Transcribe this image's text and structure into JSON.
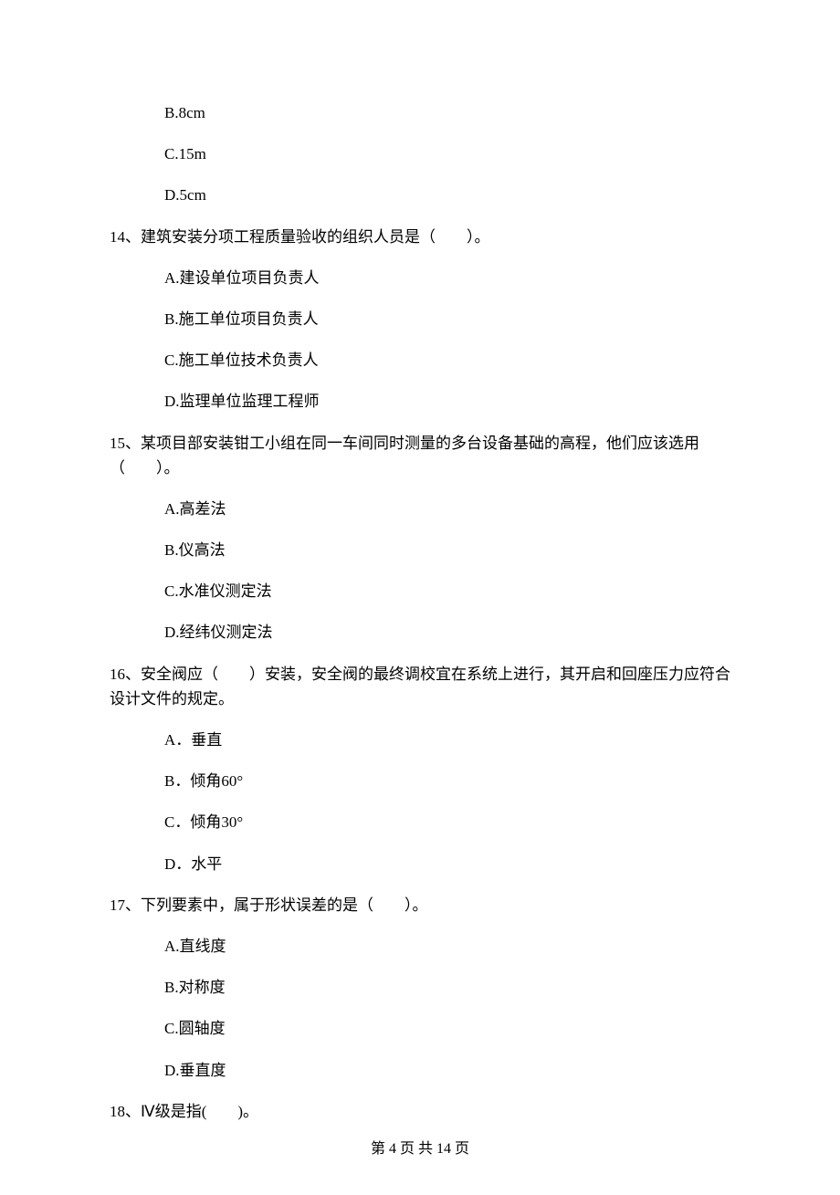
{
  "options_top": {
    "B": "B.8cm",
    "C": "C.15m",
    "D": "D.5cm"
  },
  "q14": {
    "text": "14、建筑安装分项工程质量验收的组织人员是（　　）。",
    "A": "A.建设单位项目负责人",
    "B": "B.施工单位项目负责人",
    "C": "C.施工单位技术负责人",
    "D": "D.监理单位监理工程师"
  },
  "q15": {
    "text": "15、某项目部安装钳工小组在同一车间同时测量的多台设备基础的高程，他们应该选用（　　）。",
    "A": "A.高差法",
    "B": "B.仪高法",
    "C": "C.水准仪测定法",
    "D": "D.经纬仪测定法"
  },
  "q16": {
    "text": "16、安全阀应（　　）安装，安全阀的最终调校宜在系统上进行，其开启和回座压力应符合设计文件的规定。",
    "A": "A．垂直",
    "B": "B．倾角60°",
    "C": "C．倾角30°",
    "D": "D．水平"
  },
  "q17": {
    "text": "17、下列要素中，属于形状误差的是（　　）。",
    "A": "A.直线度",
    "B": "B.对称度",
    "C": "C.圆轴度",
    "D": "D.垂直度"
  },
  "q18": {
    "text": "18、Ⅳ级是指(　　)。"
  },
  "pageNumber": "第 4 页 共 14 页"
}
